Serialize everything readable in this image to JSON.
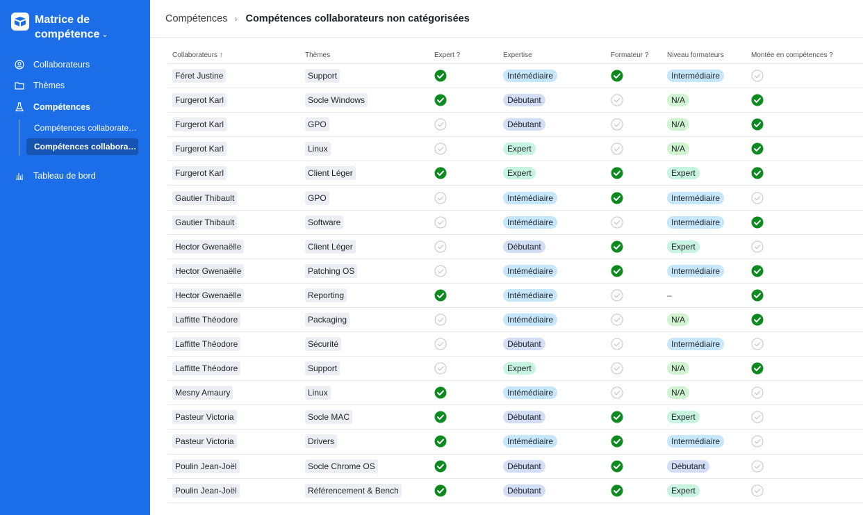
{
  "app": {
    "title": "Matrice de compétence",
    "logo_icon": "app-logo-icon"
  },
  "sidebar": {
    "items": [
      {
        "label": "Collaborateurs",
        "icon": "user-circle-icon"
      },
      {
        "label": "Thèmes",
        "icon": "folder-icon"
      },
      {
        "label": "Compétences",
        "icon": "flask-icon"
      },
      {
        "label": "Tableau de bord",
        "icon": "bar-chart-icon"
      }
    ],
    "sub_items": [
      {
        "label": "Compétences collaborateurs"
      },
      {
        "label": "Compétences collaborateurs non catégorisées"
      }
    ],
    "bg_color": "#1c6ee8"
  },
  "header": {
    "breadcrumb_root": "Compétences",
    "breadcrumb_current": "Compétences collaborateurs non catégorisées"
  },
  "table": {
    "columns": [
      "Collaborateurs",
      "Thèmes",
      "Expert ?",
      "Expertise",
      "Formateur ?",
      "Niveau formateurs",
      "Montée en compétences ?"
    ],
    "sort_indicator": "↑",
    "rows": [
      {
        "collab": "Féret Justine",
        "theme": "Support",
        "expert": true,
        "expertise": "Intémédiaire",
        "formateur": true,
        "niveau": "Intermédiaire",
        "montee": false
      },
      {
        "collab": "Furgerot Karl",
        "theme": "Socle Windows",
        "expert": true,
        "expertise": "Débutant",
        "formateur": false,
        "niveau": "N/A",
        "montee": true
      },
      {
        "collab": "Furgerot Karl",
        "theme": "GPO",
        "expert": false,
        "expertise": "Débutant",
        "formateur": false,
        "niveau": "N/A",
        "montee": true
      },
      {
        "collab": "Furgerot Karl",
        "theme": "Linux",
        "expert": false,
        "expertise": "Expert",
        "formateur": false,
        "niveau": "N/A",
        "montee": true
      },
      {
        "collab": "Furgerot Karl",
        "theme": "Client Léger",
        "expert": true,
        "expertise": "Expert",
        "formateur": true,
        "niveau": "Expert",
        "montee": true
      },
      {
        "collab": "Gautier Thibault",
        "theme": "GPO",
        "expert": false,
        "expertise": "Intémédiaire",
        "formateur": true,
        "niveau": "Intermédiaire",
        "montee": false
      },
      {
        "collab": "Gautier Thibault",
        "theme": "Software",
        "expert": false,
        "expertise": "Intémédiaire",
        "formateur": false,
        "niveau": "Intermédiaire",
        "montee": true
      },
      {
        "collab": "Hector Gwenaëlle",
        "theme": "Client Léger",
        "expert": false,
        "expertise": "Débutant",
        "formateur": true,
        "niveau": "Expert",
        "montee": false
      },
      {
        "collab": "Hector Gwenaëlle",
        "theme": "Patching OS",
        "expert": false,
        "expertise": "Intémédiaire",
        "formateur": true,
        "niveau": "Intermédiaire",
        "montee": true
      },
      {
        "collab": "Hector Gwenaëlle",
        "theme": "Reporting",
        "expert": true,
        "expertise": "Intémédiaire",
        "formateur": false,
        "niveau": "–",
        "montee": true
      },
      {
        "collab": "Laffitte Théodore",
        "theme": "Packaging",
        "expert": false,
        "expertise": "Intémédiaire",
        "formateur": false,
        "niveau": "N/A",
        "montee": true
      },
      {
        "collab": "Laffitte Théodore",
        "theme": "Sécurité",
        "expert": false,
        "expertise": "Débutant",
        "formateur": false,
        "niveau": "Intermédiaire",
        "montee": false
      },
      {
        "collab": "Laffitte Théodore",
        "theme": "Support",
        "expert": false,
        "expertise": "Expert",
        "formateur": false,
        "niveau": "N/A",
        "montee": true
      },
      {
        "collab": "Mesny Amaury",
        "theme": "Linux",
        "expert": true,
        "expertise": "Intémédiaire",
        "formateur": false,
        "niveau": "N/A",
        "montee": false
      },
      {
        "collab": "Pasteur Victoria",
        "theme": "Socle MAC",
        "expert": true,
        "expertise": "Débutant",
        "formateur": true,
        "niveau": "Expert",
        "montee": false
      },
      {
        "collab": "Pasteur Victoria",
        "theme": "Drivers",
        "expert": true,
        "expertise": "Intémédiaire",
        "formateur": true,
        "niveau": "Intermédiaire",
        "montee": false
      },
      {
        "collab": "Poulin Jean-Joël",
        "theme": "Socle Chrome OS",
        "expert": true,
        "expertise": "Débutant",
        "formateur": true,
        "niveau": "Débutant",
        "montee": false
      },
      {
        "collab": "Poulin Jean-Joël",
        "theme": "Référencement & Bench",
        "expert": true,
        "expertise": "Débutant",
        "formateur": true,
        "niveau": "Expert",
        "montee": false
      }
    ]
  },
  "colors": {
    "check_on": "#0c8a1f",
    "check_off": "#c4c4c4",
    "pill_intermediaire": "#c6e6fb",
    "pill_debutant": "#d2ddf6",
    "pill_expert": "#c7f4e1",
    "pill_na": "#d0f3d0"
  }
}
